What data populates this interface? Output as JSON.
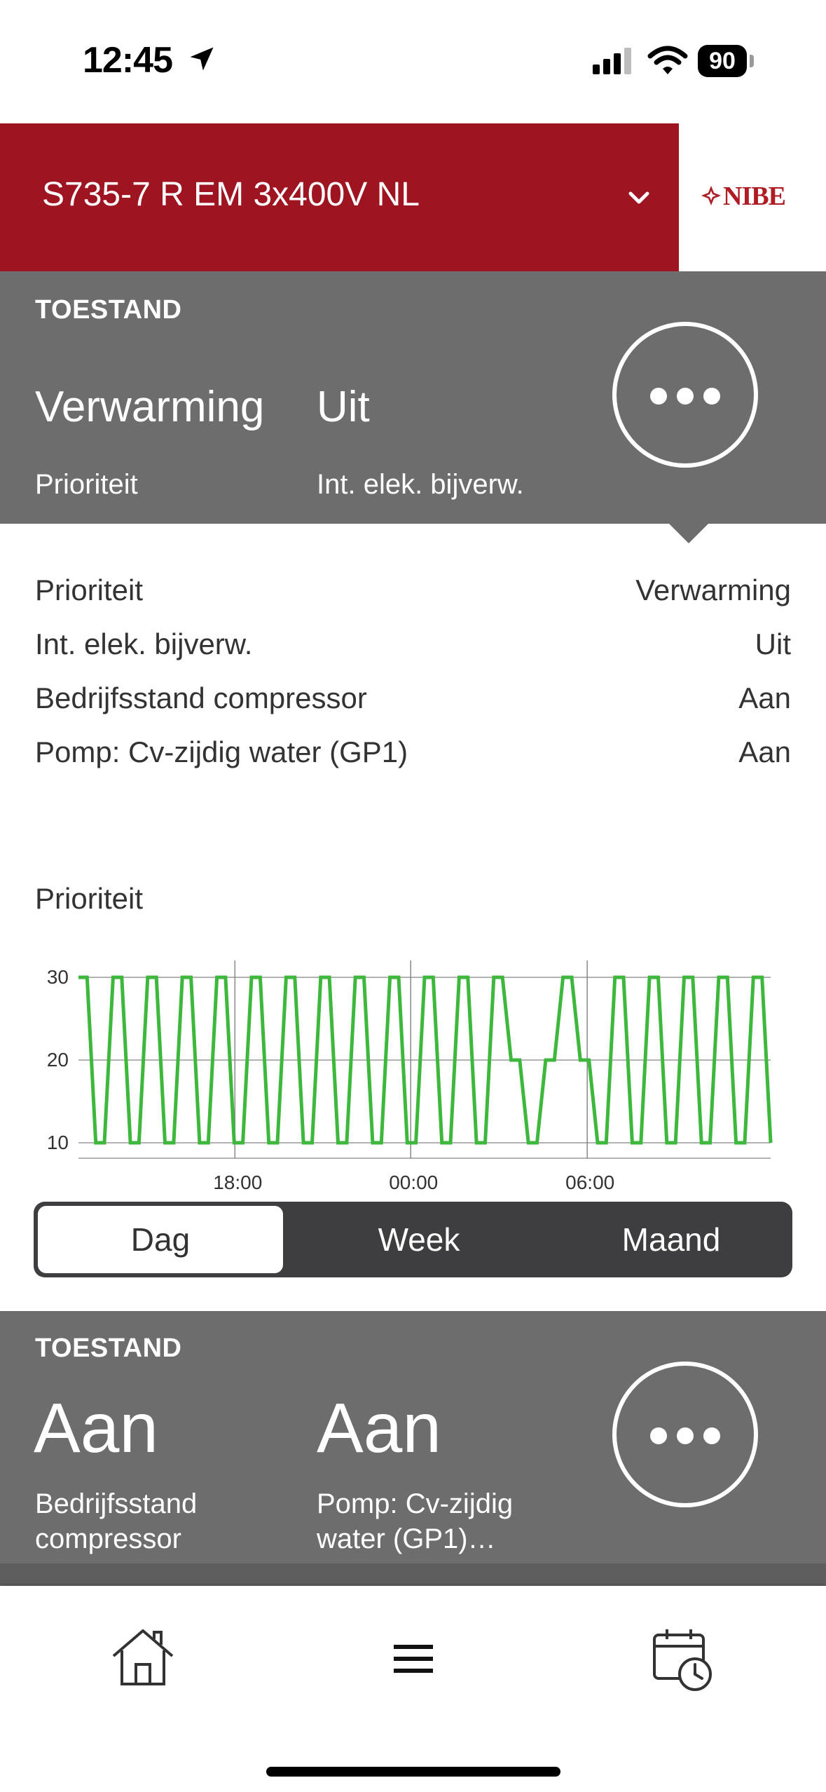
{
  "status_bar": {
    "time": "12:45",
    "battery": "90"
  },
  "header": {
    "device_name": "S735-7 R EM 3x400V NL",
    "brand": "NIBE"
  },
  "panel1": {
    "tag": "TOESTAND",
    "values": [
      {
        "value": "Verwarming",
        "label": "Prioriteit"
      },
      {
        "value": "Uit",
        "label": "Int. elek. bijverw."
      }
    ]
  },
  "details": [
    {
      "label": "Prioriteit",
      "value": "Verwarming"
    },
    {
      "label": "Int. elek. bijverw.",
      "value": "Uit"
    },
    {
      "label": "Bedrijfsstand compressor",
      "value": "Aan"
    },
    {
      "label": "Pomp: Cv-zijdig water (GP1)",
      "value": "Aan"
    }
  ],
  "chart_title": "Prioriteit",
  "chart_data": {
    "type": "line",
    "title": "Prioriteit",
    "xlabel": "",
    "ylabel": "",
    "y_ticks": [
      "30",
      "20",
      "10"
    ],
    "x_ticks": [
      "18:00",
      "00:00",
      "06:00"
    ],
    "ylim": [
      10,
      30
    ],
    "grid": true,
    "color": "#3db83d",
    "series": [
      {
        "values": [
          30,
          30,
          10,
          10,
          30,
          30,
          10,
          10,
          30,
          30,
          10,
          10,
          30,
          30,
          10,
          10,
          30,
          30,
          10,
          10,
          30,
          30,
          10,
          10,
          30,
          30,
          10,
          10,
          30,
          30,
          10,
          10,
          30,
          30,
          10,
          10,
          30,
          30,
          10,
          10,
          30,
          30,
          10,
          10,
          30,
          30,
          10,
          10,
          30,
          30,
          20,
          20,
          10,
          10,
          20,
          20,
          30,
          30,
          20,
          20,
          10,
          10,
          30,
          30,
          10,
          10,
          30,
          30,
          10,
          10,
          30,
          30,
          10,
          10,
          30,
          30,
          10,
          10,
          30,
          30,
          10
        ]
      }
    ]
  },
  "segments": {
    "items": [
      "Dag",
      "Week",
      "Maand"
    ],
    "selected": "Dag"
  },
  "panel2": {
    "tag": "TOESTAND",
    "values": [
      {
        "value": "Aan",
        "label": "Bedrijfsstand compressor"
      },
      {
        "value": "Aan",
        "label": "Pomp: Cv-zijdig water (GP1)…"
      }
    ]
  },
  "colors": {
    "brand_red": "#9e1420",
    "panel_grey": "#6d6d6d",
    "line_green": "#3db83d",
    "segment_dark": "#3e3e40"
  },
  "icons": [
    "location-arrow-icon",
    "signal-icon",
    "wifi-icon",
    "battery-icon",
    "chevron-down-icon",
    "nibe-logo",
    "more-icon",
    "home-icon",
    "menu-icon",
    "schedule-icon"
  ]
}
